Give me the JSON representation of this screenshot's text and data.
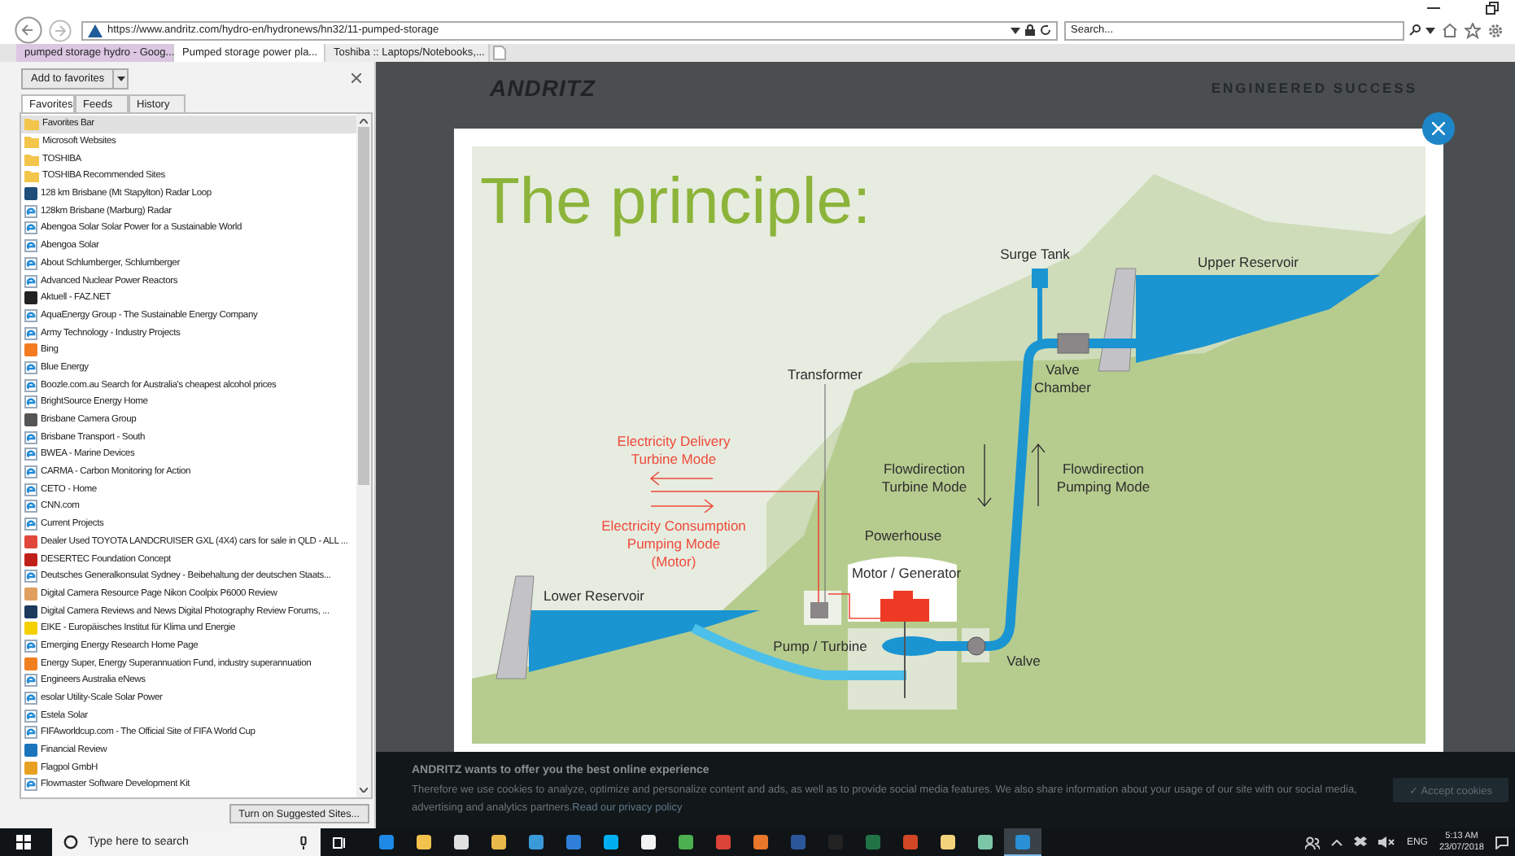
{
  "browser": {
    "address": "https://www.andritz.com/hydro-en/hydronews/hn32/11-pumped-storage",
    "search": {
      "placeholder": "Search..."
    },
    "tabs": [
      {
        "title": "pumped storage hydro - Goog...",
        "selected": false
      },
      {
        "title": "Pumped storage power pla...",
        "selected": true
      },
      {
        "title": "Toshiba :: Laptops/Notebooks,...",
        "selected": false
      }
    ]
  },
  "favorites_pane": {
    "add_button": "Add to favorites",
    "tabs": [
      {
        "label": "Favorites",
        "selected": true
      },
      {
        "label": "Feeds",
        "selected": false
      },
      {
        "label": "History",
        "selected": false
      }
    ],
    "items": [
      {
        "kind": "folder",
        "label": "Favorites Bar",
        "selected": true
      },
      {
        "kind": "folder",
        "label": "Microsoft Websites",
        "selected": false
      },
      {
        "kind": "folder",
        "label": "TOSHIBA",
        "selected": false
      },
      {
        "kind": "folder",
        "label": "TOSHIBA Recommended Sites",
        "selected": false
      },
      {
        "kind": "site",
        "label": "128 km Brisbane (Mt Stapylton) Radar Loop",
        "color": "#1e4e79",
        "selected": false
      },
      {
        "kind": "page",
        "label": "128km Brisbane (Marburg) Radar",
        "selected": false
      },
      {
        "kind": "page",
        "label": "Abengoa Solar  Solar Power for a Sustainable World",
        "selected": false
      },
      {
        "kind": "page",
        "label": "Abengoa Solar",
        "selected": false
      },
      {
        "kind": "page",
        "label": "About Schlumberger, Schlumberger",
        "selected": false
      },
      {
        "kind": "page",
        "label": "Advanced Nuclear Power Reactors",
        "selected": false
      },
      {
        "kind": "site",
        "label": "Aktuell - FAZ.NET",
        "color": "#222222",
        "selected": false
      },
      {
        "kind": "page",
        "label": "AquaEnergy Group - The Sustainable Energy Company",
        "selected": false
      },
      {
        "kind": "page",
        "label": "Army Technology - Industry Projects",
        "selected": false
      },
      {
        "kind": "site",
        "label": "Bing",
        "color": "#f47b20",
        "selected": false
      },
      {
        "kind": "page",
        "label": "Blue Energy",
        "selected": false
      },
      {
        "kind": "page",
        "label": "Boozle.com.au  Search for Australia's cheapest alcohol prices",
        "selected": false
      },
      {
        "kind": "page",
        "label": "BrightSource Energy  Home",
        "selected": false
      },
      {
        "kind": "site",
        "label": "Brisbane Camera Group",
        "color": "#555555",
        "selected": false
      },
      {
        "kind": "page",
        "label": "Brisbane Transport - South",
        "selected": false
      },
      {
        "kind": "page",
        "label": "BWEA - Marine Devices",
        "selected": false
      },
      {
        "kind": "page",
        "label": "CARMA - Carbon Monitoring for Action",
        "selected": false
      },
      {
        "kind": "page",
        "label": "CETO - Home",
        "selected": false
      },
      {
        "kind": "page",
        "label": "CNN.com",
        "selected": false
      },
      {
        "kind": "page",
        "label": "Current Projects",
        "selected": false
      },
      {
        "kind": "site",
        "label": "Dealer Used TOYOTA LANDCRUISER GXL (4X4) cars for sale in QLD - ALL ...",
        "color": "#e0463a",
        "selected": false
      },
      {
        "kind": "site",
        "label": "DESERTEC Foundation Concept",
        "color": "#c0201a",
        "selected": false
      },
      {
        "kind": "page",
        "label": "Deutsches Generalkonsulat Sydney - Beibehaltung der deutschen Staats...",
        "selected": false
      },
      {
        "kind": "site",
        "label": "Digital Camera Resource Page Nikon Coolpix P6000 Review",
        "color": "#e0a060",
        "selected": false
      },
      {
        "kind": "site",
        "label": "Digital Camera Reviews and News Digital Photography Review Forums, ...",
        "color": "#1d3a5c",
        "selected": false
      },
      {
        "kind": "site",
        "label": "EIKE - Europäisches Institut für Klima und Energie",
        "color": "#f5d000",
        "selected": false
      },
      {
        "kind": "page",
        "label": "Emerging Energy Research Home Page",
        "selected": false
      },
      {
        "kind": "site",
        "label": "Energy Super, Energy Superannuation Fund, industry superannuation",
        "color": "#f08020",
        "selected": false
      },
      {
        "kind": "page",
        "label": "Engineers Australia eNews",
        "selected": false
      },
      {
        "kind": "page",
        "label": "esolar Utility-Scale Solar Power",
        "selected": false
      },
      {
        "kind": "page",
        "label": "Estela Solar",
        "selected": false
      },
      {
        "kind": "page",
        "label": "FIFAworldcup.com - The Official Site of FIFA World Cup",
        "selected": false
      },
      {
        "kind": "site",
        "label": "Financial Review",
        "color": "#1b75bb",
        "selected": false
      },
      {
        "kind": "site",
        "label": "Flagpol GmbH",
        "color": "#e8a020",
        "selected": false
      },
      {
        "kind": "page",
        "label": "Flowmaster Software Development Kit",
        "selected": false
      }
    ],
    "suggested_button": "Turn on Suggested Sites..."
  },
  "page": {
    "logo": "ANDRITZ",
    "tagline": "ENGINEERED SUCCESS",
    "diagram": {
      "title": "The principle:",
      "labels": [
        {
          "kind": "plain",
          "lines": [
            "Surge Tank"
          ]
        },
        {
          "kind": "plain",
          "lines": [
            "Upper Reservoir"
          ]
        },
        {
          "kind": "plain",
          "lines": [
            "Transformer"
          ]
        },
        {
          "kind": "plain",
          "lines": [
            "Valve",
            "Chamber"
          ]
        },
        {
          "kind": "electric",
          "lines": [
            "Electricity Delivery",
            "Turbine Mode"
          ]
        },
        {
          "kind": "plain",
          "lines": [
            "Flowdirection",
            "Turbine Mode"
          ]
        },
        {
          "kind": "plain",
          "lines": [
            "Flowdirection",
            "Pumping Mode"
          ]
        },
        {
          "kind": "electric",
          "lines": [
            "Electricity Consumption",
            "Pumping Mode",
            "(Motor)"
          ]
        },
        {
          "kind": "plain",
          "lines": [
            "Powerhouse"
          ]
        },
        {
          "kind": "plain",
          "lines": [
            "Motor / Generator"
          ]
        },
        {
          "kind": "plain",
          "lines": [
            "Lower Reservoir"
          ]
        },
        {
          "kind": "plain",
          "lines": [
            "Pump / Turbine"
          ]
        },
        {
          "kind": "plain",
          "lines": [
            "Valve"
          ]
        }
      ]
    }
  },
  "cookie_banner": {
    "title": "ANDRITZ wants to offer you the best online experience",
    "text": "Therefore we use cookies to analyze, optimize and personalize content and ads, as well as to provide social media features. We also share information about your usage of our site with our social media, advertising and analytics partners.",
    "link": "Read our privacy policy",
    "button": "✓ Accept cookies"
  },
  "taskbar": {
    "search": {
      "placeholder": "Type here to search"
    },
    "apps": [
      {
        "selected": false
      },
      {
        "selected": false
      },
      {
        "selected": false
      },
      {
        "selected": false
      },
      {
        "selected": false
      },
      {
        "selected": false
      },
      {
        "selected": false
      },
      {
        "selected": false
      },
      {
        "selected": false
      },
      {
        "selected": false
      },
      {
        "selected": false
      },
      {
        "selected": false
      },
      {
        "selected": false
      },
      {
        "selected": false
      },
      {
        "selected": false
      },
      {
        "selected": false
      },
      {
        "selected": false
      },
      {
        "selected": true
      }
    ],
    "language": "ENG",
    "time": "5:13 AM",
    "date": "23/07/2018"
  }
}
